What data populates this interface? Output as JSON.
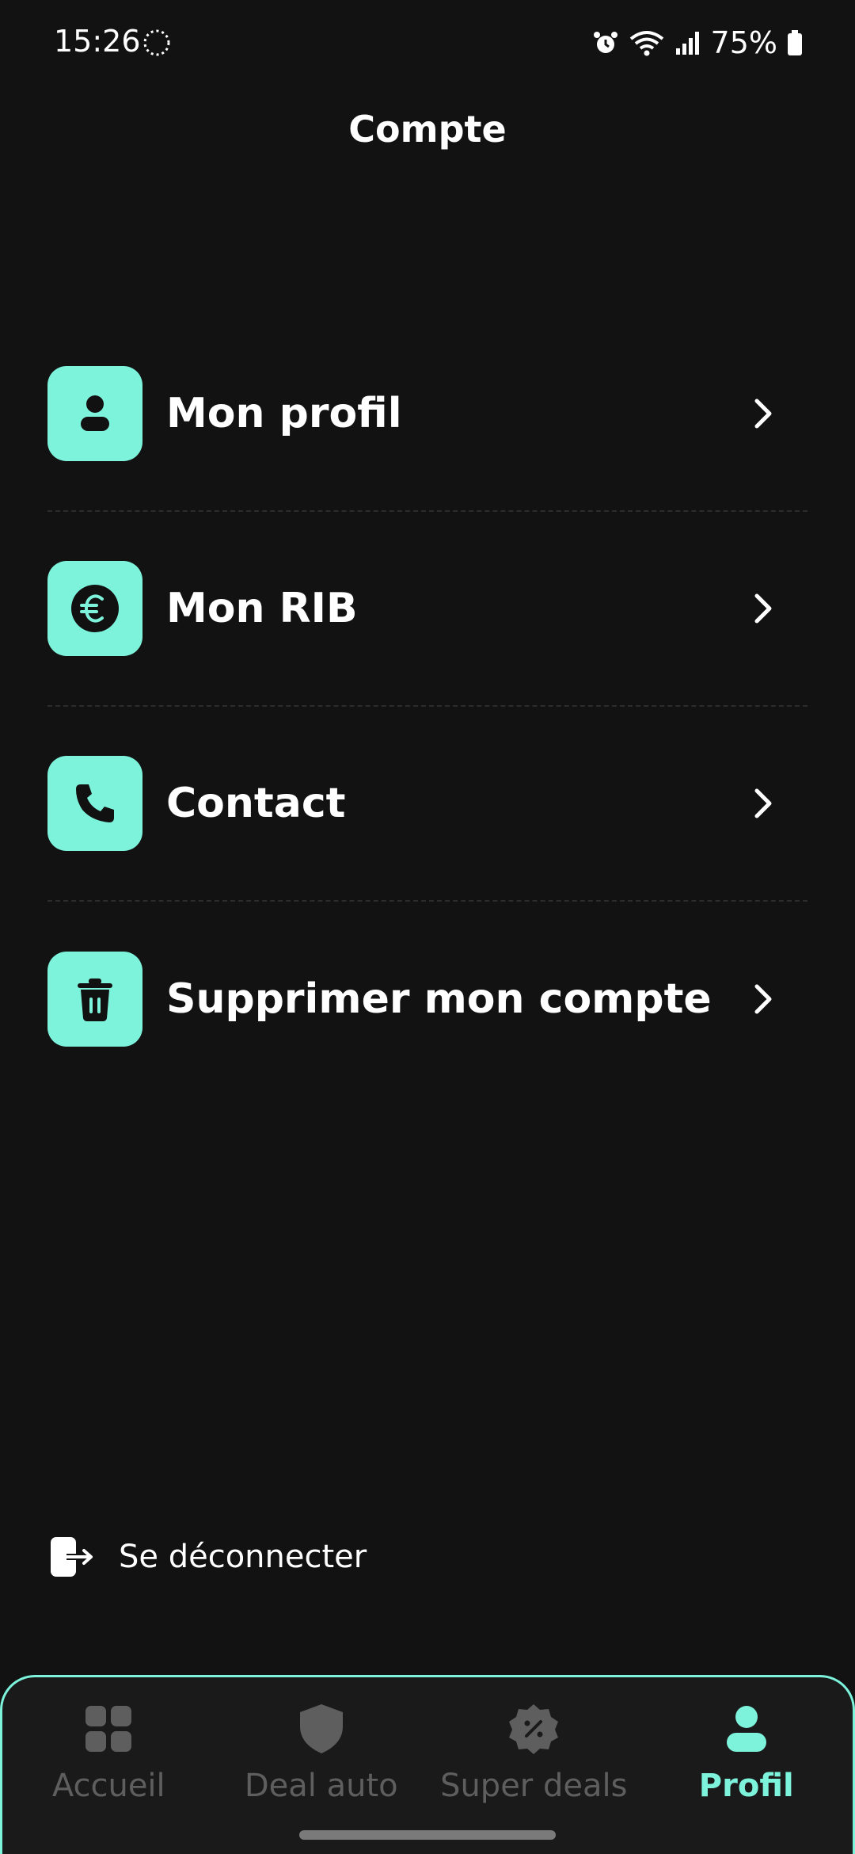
{
  "status_bar": {
    "time": "15:26",
    "battery": "75%",
    "icons": [
      "loading-icon",
      "alarm-icon",
      "wifi-icon",
      "signal-icon",
      "battery-icon"
    ]
  },
  "header": {
    "title": "Compte"
  },
  "menu": {
    "items": [
      {
        "label": "Mon profil",
        "icon": "user-icon"
      },
      {
        "label": "Mon RIB",
        "icon": "euro-icon"
      },
      {
        "label": "Contact",
        "icon": "phone-icon"
      },
      {
        "label": "Supprimer mon compte",
        "icon": "trash-icon"
      }
    ]
  },
  "logout": {
    "label": "Se déconnecter",
    "icon": "logout-icon"
  },
  "bottom_nav": {
    "items": [
      {
        "label": "Accueil",
        "icon": "grid-icon",
        "active": false
      },
      {
        "label": "Deal auto",
        "icon": "shield-icon",
        "active": false
      },
      {
        "label": "Super deals",
        "icon": "percent-badge-icon",
        "active": false
      },
      {
        "label": "Profil",
        "icon": "user-icon",
        "active": true
      }
    ]
  },
  "colors": {
    "background": "#121212",
    "accent": "#7ef3dc",
    "text": "#ffffff",
    "inactive": "#5e5e5e"
  }
}
